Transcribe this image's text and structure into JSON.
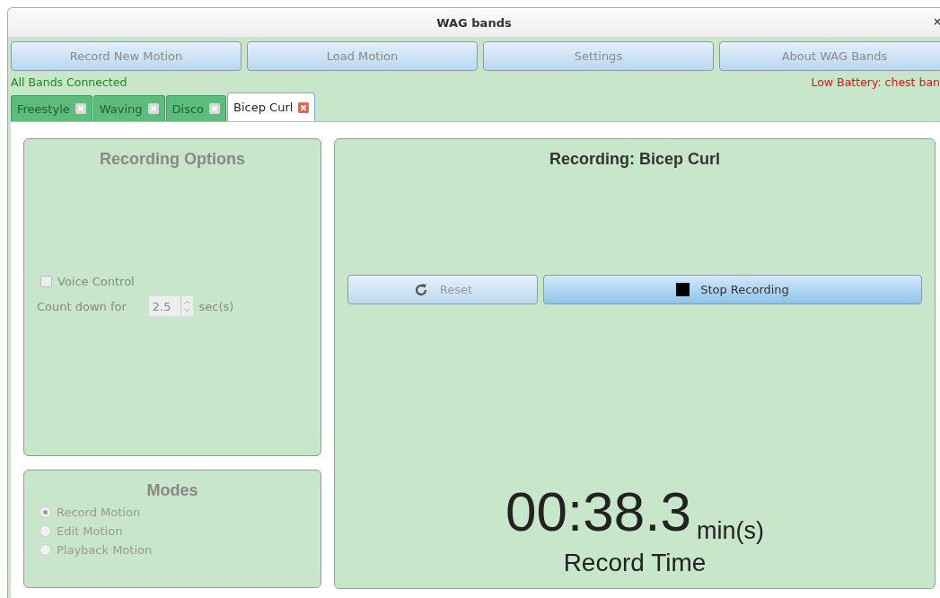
{
  "window": {
    "title": "WAG bands",
    "close": "×"
  },
  "toolbar": [
    {
      "label": "Record New Motion",
      "disabled": true
    },
    {
      "label": "Load Motion",
      "disabled": true
    },
    {
      "label": "Settings",
      "disabled": true
    },
    {
      "label": "About WAG Bands",
      "disabled": true
    }
  ],
  "status": {
    "connection": "All Bands Connected",
    "battery": "Low Battery: chest ban"
  },
  "tabs": [
    {
      "label": "Freestyle",
      "selected": false,
      "disabled": true
    },
    {
      "label": "Waving",
      "selected": false,
      "disabled": true
    },
    {
      "label": "Disco",
      "selected": false,
      "disabled": true
    },
    {
      "label": "Bicep Curl",
      "selected": true,
      "disabled": false
    }
  ],
  "recording_options": {
    "title": "Recording Options",
    "disabled": true,
    "voice_control": {
      "label": "Voice Control",
      "checked": false
    },
    "countdown": {
      "label": "Count down for",
      "value": "2.5",
      "unit": "sec(s)"
    }
  },
  "modes": {
    "title": "Modes",
    "disabled": true,
    "options": [
      {
        "label": "Record Motion",
        "selected": true
      },
      {
        "label": "Edit Motion",
        "selected": false
      },
      {
        "label": "Playback Motion",
        "selected": false
      }
    ]
  },
  "recording": {
    "title": "Recording: Bicep Curl",
    "buttons": [
      {
        "kind": "reset",
        "label": "Reset",
        "disabled": true
      },
      {
        "kind": "stop",
        "label": "Stop Recording",
        "disabled": false
      }
    ],
    "time": "00:38.3",
    "unit": "min(s)",
    "caption": "Record Time"
  }
}
